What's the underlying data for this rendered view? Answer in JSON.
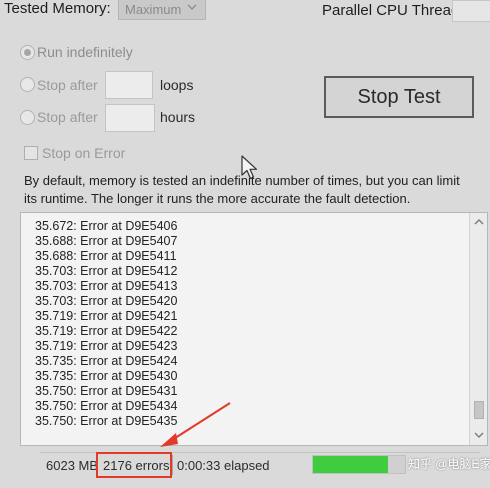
{
  "settings": {
    "tested_memory_label": "Tested Memory:",
    "tested_memory_value": "Maximum",
    "cpu_threads_label": "Parallel CPU Threads:",
    "cpu_threads_value": ""
  },
  "options": {
    "run_indefinitely": {
      "label": "Run indefinitely",
      "checked": true
    },
    "stop_after_loops": {
      "label": "Stop after",
      "value": "",
      "unit": "loops"
    },
    "stop_after_hours": {
      "label": "Stop after",
      "value": "",
      "unit": "hours"
    },
    "stop_on_error": {
      "label": "Stop on Error",
      "checked": false
    }
  },
  "actions": {
    "stop_test_label": "Stop Test"
  },
  "description": "By default, memory is tested an indefinite number of times, but you can limit its runtime. The longer it runs the more accurate the fault detection.",
  "log_lines": [
    "35.672: Error at D9E5406",
    "35.688: Error at D9E5407",
    "35.688: Error at D9E5411",
    "35.703: Error at D9E5412",
    "35.703: Error at D9E5413",
    "35.703: Error at D9E5420",
    "35.719: Error at D9E5421",
    "35.719: Error at D9E5422",
    "35.719: Error at D9E5423",
    "35.735: Error at D9E5424",
    "35.735: Error at D9E5430",
    "35.750: Error at D9E5431",
    "35.750: Error at D9E5434",
    "35.750: Error at D9E5435"
  ],
  "status": {
    "memory": "6023 MB",
    "errors": "2176 errors",
    "elapsed": "0:00:33 elapsed",
    "progress": 0.82
  },
  "watermark": "知乎 @电脑E家",
  "icons": {
    "dropdown": "chevron-down-icon",
    "cursor": "mouse-pointer-icon",
    "scroll_up": "chevron-up-icon",
    "scroll_down": "chevron-down-icon"
  },
  "colors": {
    "progress_fill": "#3fcc3f",
    "annotation_red": "#e23a2a"
  }
}
